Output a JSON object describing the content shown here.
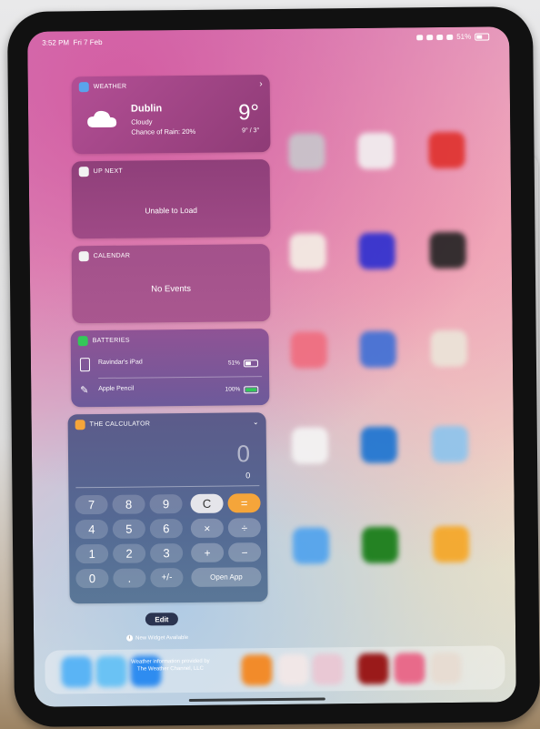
{
  "status": {
    "time": "3:52 PM",
    "date": "Fri 7 Feb",
    "battery": "51%"
  },
  "weather": {
    "header": "WEATHER",
    "city": "Dublin",
    "condition": "Cloudy",
    "rain": "Chance of Rain: 20%",
    "temp": "9°",
    "hilo": "9° / 3°",
    "accent": "#8e3b76"
  },
  "upnext": {
    "header": "UP NEXT",
    "message": "Unable to Load"
  },
  "calendar": {
    "header": "CALENDAR",
    "message": "No Events"
  },
  "batteries": {
    "header": "BATTERIES",
    "devices": [
      {
        "name": "Ravindar's iPad",
        "percent": "51%",
        "level": 0.51
      },
      {
        "name": "Apple Pencil",
        "percent": "100%",
        "level": 1.0
      }
    ]
  },
  "calculator": {
    "header": "THE CALCULATOR",
    "display_main": "0",
    "display_sub": "0",
    "buttons": {
      "k7": "7",
      "k8": "8",
      "k9": "9",
      "clear": "C",
      "equals": "=",
      "k4": "4",
      "k5": "5",
      "k6": "6",
      "mul": "×",
      "div": "÷",
      "k1": "1",
      "k2": "2",
      "k3": "3",
      "add": "+",
      "sub": "−",
      "k0": "0",
      "dot": ".",
      "sign": "+/-",
      "open": "Open App"
    },
    "orange": "#f5a53a"
  },
  "footer": {
    "edit": "Edit",
    "new_widget": "New Widget Available",
    "attribution_line1": "Weather information provided by",
    "attribution_line2": "The Weather Channel, LLC"
  }
}
